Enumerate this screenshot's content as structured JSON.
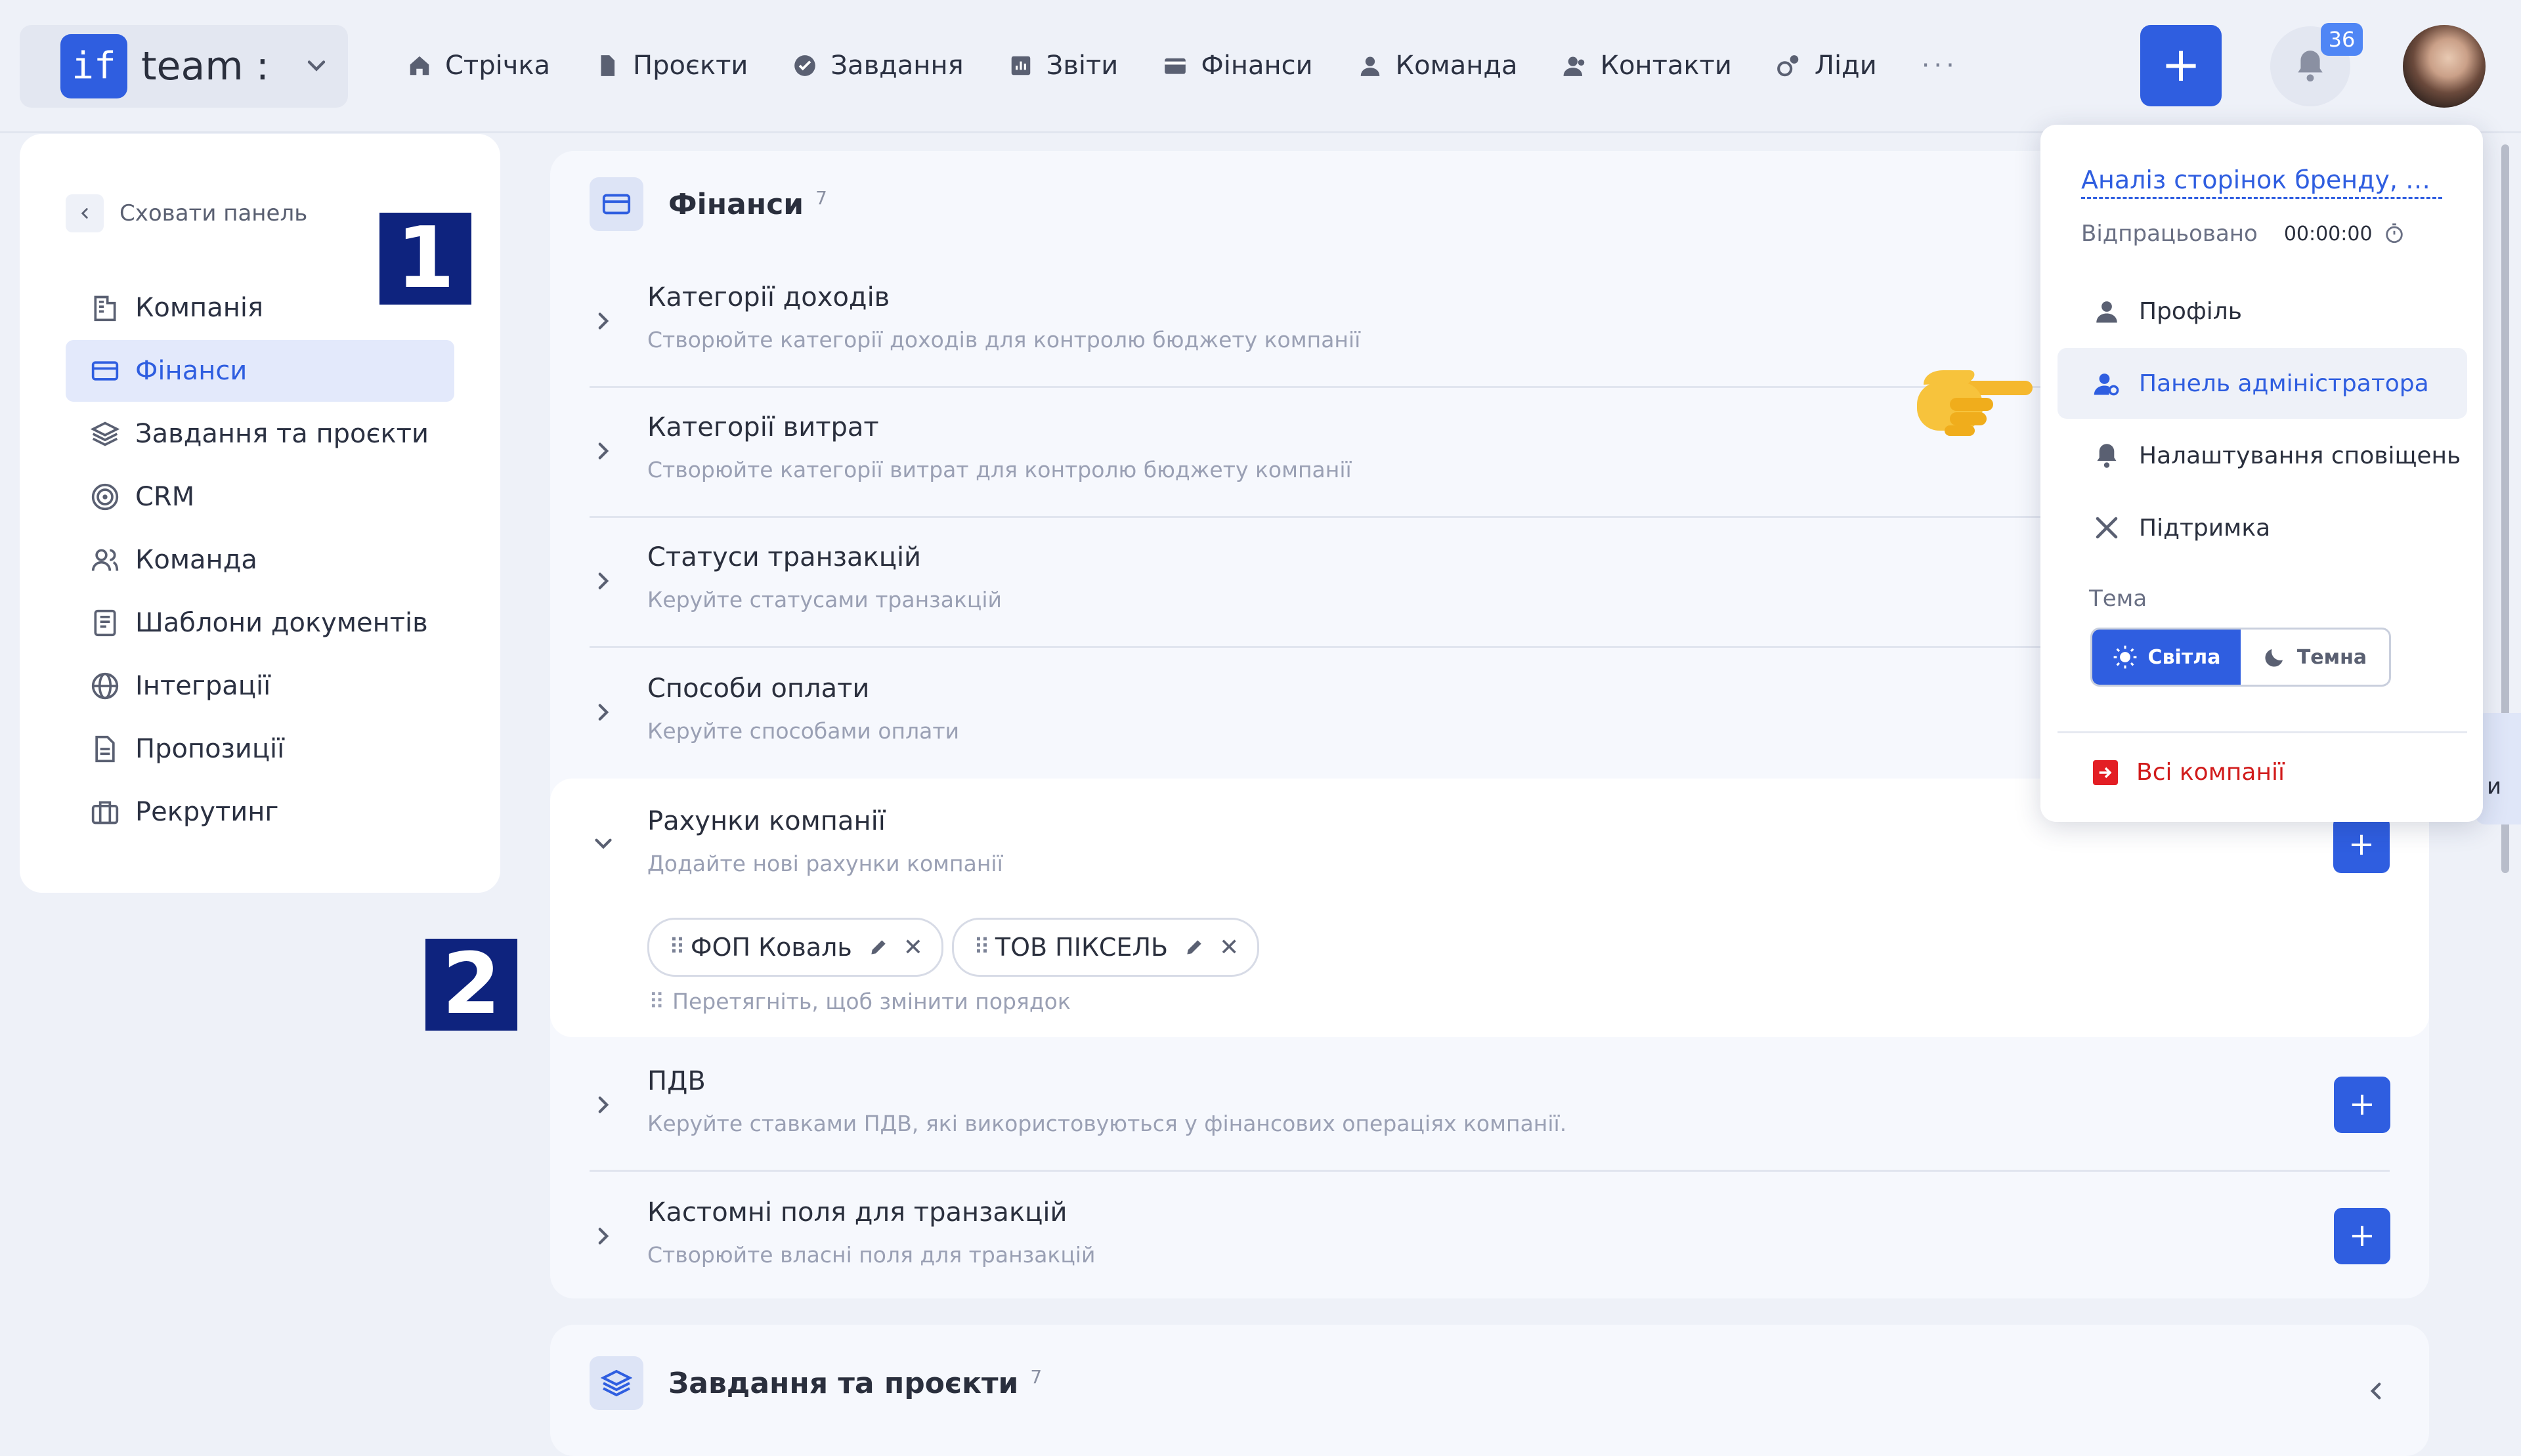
{
  "brand": {
    "logo_text": "if",
    "name": "team :"
  },
  "nav": [
    {
      "label": "Стрічка",
      "icon": "home-icon"
    },
    {
      "label": "Проєкти",
      "icon": "file-icon"
    },
    {
      "label": "Завдання",
      "icon": "check-circle-icon"
    },
    {
      "label": "Звіти",
      "icon": "report-icon"
    },
    {
      "label": "Фінанси",
      "icon": "wallet-icon"
    },
    {
      "label": "Команда",
      "icon": "user-icon"
    },
    {
      "label": "Контакти",
      "icon": "contacts-icon"
    },
    {
      "label": "Ліди",
      "icon": "leads-icon"
    }
  ],
  "nav_more": "···",
  "add_label": "+",
  "notifications": {
    "count": "36"
  },
  "sidebar": {
    "hide_label": "Сховати панель",
    "items": [
      {
        "label": "Компанія",
        "icon": "company-icon"
      },
      {
        "label": "Фінанси",
        "icon": "card-icon",
        "active": true
      },
      {
        "label": "Завдання та проєкти",
        "icon": "layers-icon"
      },
      {
        "label": "CRM",
        "icon": "target-icon"
      },
      {
        "label": "Команда",
        "icon": "users-icon"
      },
      {
        "label": "Шаблони документів",
        "icon": "document-template-icon"
      },
      {
        "label": "Інтеграції",
        "icon": "globe-icon"
      },
      {
        "label": "Пропозиції",
        "icon": "proposal-icon"
      },
      {
        "label": "Рекрутинг",
        "icon": "briefcase-icon"
      }
    ]
  },
  "annotations": {
    "one": "1",
    "two": "2"
  },
  "finance": {
    "title": "Фінанси",
    "count": "7",
    "rows": [
      {
        "title": "Категорії доходів",
        "subtitle": "Створюйте категорії доходів для контролю бюджету компанії"
      },
      {
        "title": "Категорії витрат",
        "subtitle": "Створюйте категорії витрат для контролю бюджету компанії"
      },
      {
        "title": "Статуси транзакцій",
        "subtitle": "Керуйте статусами транзакцій"
      },
      {
        "title": "Способи оплати",
        "subtitle": "Керуйте способами оплати"
      },
      {
        "title": "Рахунки компанії",
        "subtitle": "Додайте нові рахунки компанії"
      },
      {
        "title": "ПДВ",
        "subtitle": "Керуйте ставками ПДВ, які використовуються у фінансових операціях компанії."
      },
      {
        "title": "Кастомні поля для транзакцій",
        "subtitle": "Створюйте власні поля для транзакцій"
      }
    ],
    "accounts": [
      "ФОП Коваль",
      "ТОВ ПІКСЕЛЬ"
    ],
    "drag_hint": "Перетягніть, щоб змінити порядок"
  },
  "tasks_section": {
    "title": "Завдання та проєкти",
    "count": "7"
  },
  "peek_text": "и",
  "menu": {
    "task": "Аналіз сторінок бренду, аудит",
    "worked_label": "Відпрацьовано",
    "worked_time": "00:00:00",
    "items": [
      {
        "label": "Профіль",
        "icon": "user-icon"
      },
      {
        "label": "Панель адміністратора",
        "icon": "admin-user-icon",
        "highlighted": true
      },
      {
        "label": "Налаштування сповіщень",
        "icon": "bell-icon"
      },
      {
        "label": "Підтримка",
        "icon": "tools-icon"
      }
    ],
    "theme_label": "Тема",
    "theme_light": "Світла",
    "theme_dark": "Темна",
    "theme_selected": "Світла",
    "exit_label": "Всі компанії"
  },
  "colors": {
    "accent": "#2f5ee0",
    "annotation": "#0e237e",
    "danger": "#d11b1b",
    "background": "#eef1f8"
  }
}
